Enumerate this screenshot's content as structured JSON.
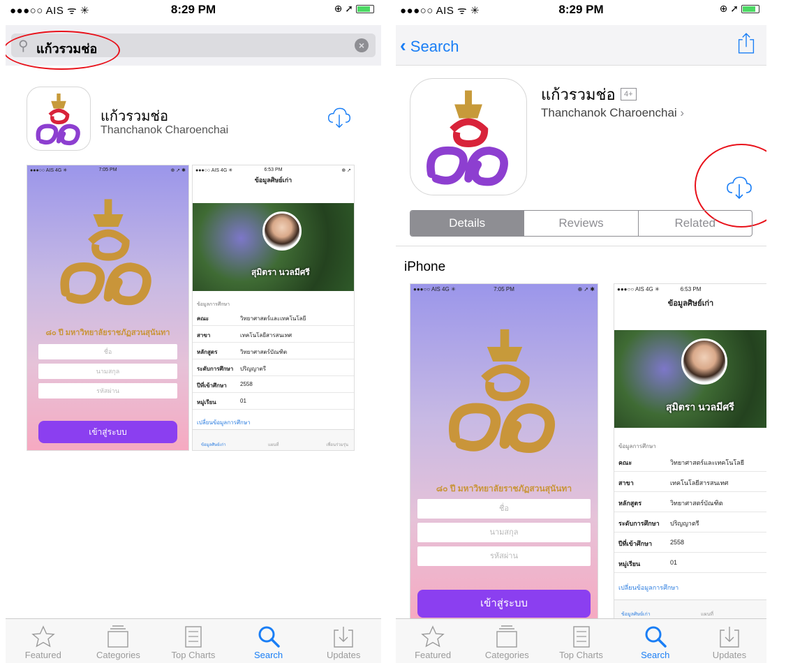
{
  "left": {
    "status": {
      "carrier": "●●●○○ AIS ᯤ ✳",
      "time": "8:29 PM",
      "icons": "⊕ ➚"
    },
    "search": {
      "query": "แก้วรวมช่อ"
    },
    "app": {
      "name": "แก้วรวมช่อ",
      "developer": "Thanchanok Charoenchai"
    },
    "shot1": {
      "status_l": "●●●○○ AIS 4G ✳",
      "status_c": "7:05 PM",
      "status_r": "⊕ ➚ ✱",
      "tagline": "๘๐ ปี มหาวิทยาลัยราชภัฏสวนสุนันทา",
      "f1": "ชื่อ",
      "f2": "นามสกุล",
      "f3": "รหัสผ่าน",
      "enter": "เข้าสู่ระบบ"
    },
    "shot2": {
      "status_l": "●●●○○ AIS 4G ✳",
      "status_c": "6:53 PM",
      "status_r": "⊕ ➚",
      "header": "ข้อมูลศิษย์เก่า",
      "name": "สุมิตรา นวลมีศรี",
      "section": "ข้อมูลการศึกษา",
      "rows": [
        {
          "k": "คณะ",
          "v": "วิทยาศาสตร์และเทคโนโลยี"
        },
        {
          "k": "สาขา",
          "v": "เทคโนโลยีสารสนเทศ"
        },
        {
          "k": "หลักสูตร",
          "v": "วิทยาศาสตร์บัณฑิต"
        },
        {
          "k": "ระดับการศึกษา",
          "v": "ปริญญาตรี"
        },
        {
          "k": "ปีที่เข้าศึกษา",
          "v": "2558"
        },
        {
          "k": "หมู่เรียน",
          "v": "01"
        }
      ],
      "link": "เปลี่ยนข้อมูลการศึกษา",
      "tab1": "ข้อมูลศิษย์เก่า",
      "tab2": "แผนที่",
      "tab3": "เพื่อนร่วมรุ่น"
    }
  },
  "right": {
    "status": {
      "carrier": "●●●○○ AIS ᯤ ✳",
      "time": "8:29 PM",
      "icons": "⊕ ➚"
    },
    "back_label": "Search",
    "app": {
      "name": "แก้วรวมช่อ",
      "age": "4+",
      "developer": "Thanchanok Charoenchai"
    },
    "segments": [
      "Details",
      "Reviews",
      "Related"
    ],
    "section_title": "iPhone",
    "shot1": {
      "status_l": "●●●○○ AIS 4G ✳",
      "status_c": "7:05 PM",
      "status_r": "⊕ ➚ ✱",
      "tagline": "๘๐ ปี มหาวิทยาลัยราชภัฏสวนสุนันทา",
      "f1": "ชื่อ",
      "f2": "นามสกุล",
      "f3": "รหัสผ่าน",
      "enter": "เข้าสู่ระบบ"
    },
    "shot2": {
      "status_l": "●●●○○ AIS 4G ✳",
      "status_c": "6:53 PM",
      "header": "ข้อมูลศิษย์เก่า",
      "name": "สุมิตรา นวลมีศรี",
      "section": "ข้อมูลการศึกษา",
      "rows": [
        {
          "k": "คณะ",
          "v": "วิทยาศาสตร์และเทคโนโลยี"
        },
        {
          "k": "สาขา",
          "v": "เทคโนโลยีสารสนเทศ"
        },
        {
          "k": "หลักสูตร",
          "v": "วิทยาศาสตร์บัณฑิต"
        },
        {
          "k": "ระดับการศึกษา",
          "v": "ปริญญาตรี"
        },
        {
          "k": "ปีที่เข้าศึกษา",
          "v": "2558"
        },
        {
          "k": "หมู่เรียน",
          "v": "01"
        }
      ],
      "link": "เปลี่ยนข้อมูลการศึกษา",
      "tab1": "ข้อมูลศิษย์เก่า",
      "tab2": "แผนที่"
    }
  },
  "tabbar": [
    "Featured",
    "Categories",
    "Top Charts",
    "Search",
    "Updates"
  ],
  "colors": {
    "accent": "#1a7ef5",
    "annotation": "#e8111a",
    "button": "#8b3ff0"
  }
}
